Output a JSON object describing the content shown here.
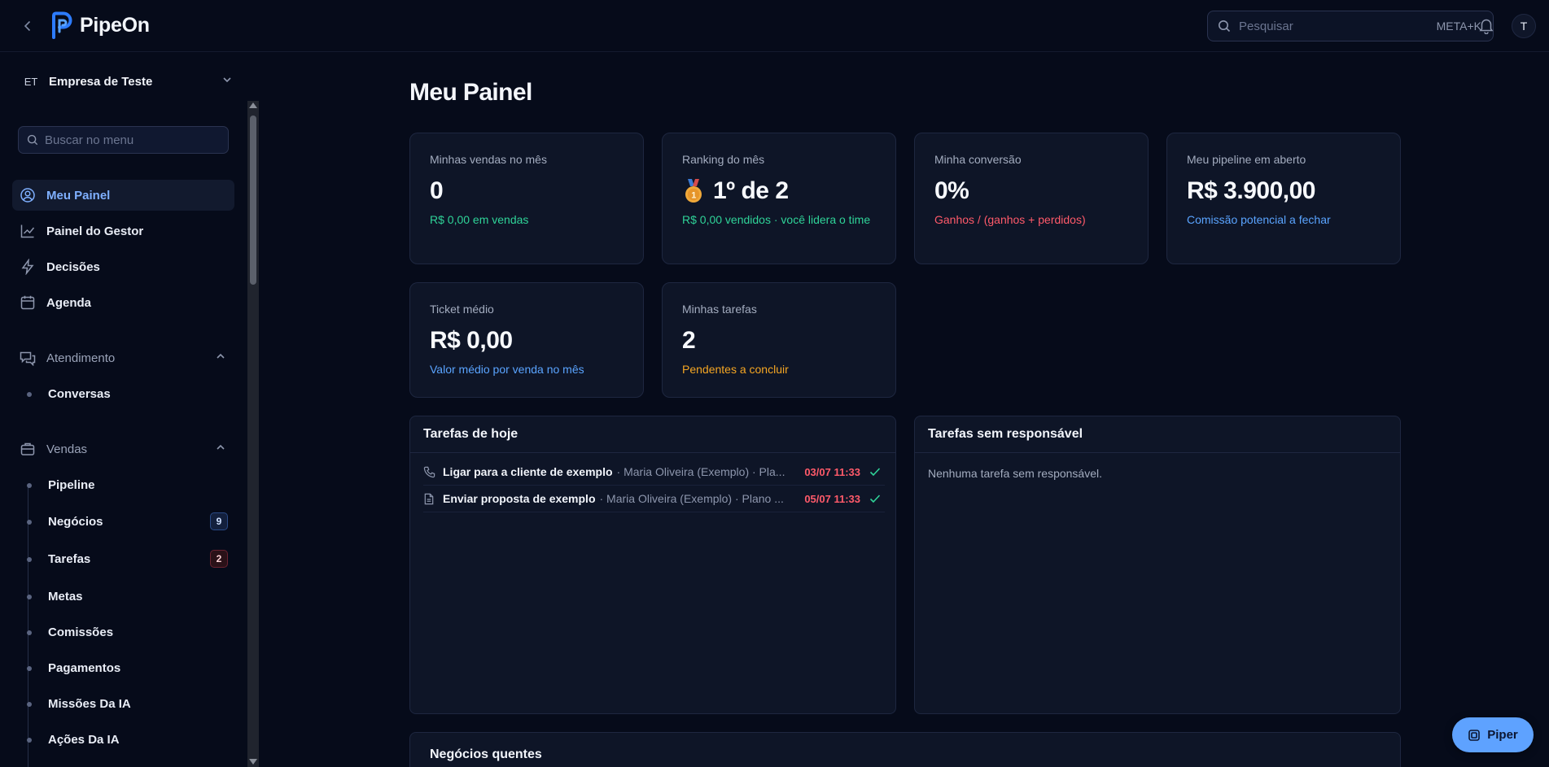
{
  "app": {
    "name": "PipeOn"
  },
  "header": {
    "search_placeholder": "Pesquisar",
    "shortcut": "META+K",
    "avatar_initial": "T"
  },
  "sidebar": {
    "company_initials": "ET",
    "company_name": "Empresa de Teste",
    "search_placeholder": "Buscar no menu",
    "items": [
      {
        "label": "Meu Painel",
        "icon": "user-circle-icon"
      },
      {
        "label": "Painel do Gestor",
        "icon": "chart-line-icon"
      },
      {
        "label": "Decisões",
        "icon": "lightning-icon"
      },
      {
        "label": "Agenda",
        "icon": "calendar-icon"
      }
    ],
    "sections": [
      {
        "label": "Atendimento",
        "icon": "chat-icon",
        "items": [
          {
            "label": "Conversas"
          }
        ]
      },
      {
        "label": "Vendas",
        "icon": "briefcase-icon",
        "items": [
          {
            "label": "Pipeline"
          },
          {
            "label": "Negócios",
            "badge": "9"
          },
          {
            "label": "Tarefas",
            "badge": "2"
          },
          {
            "label": "Metas"
          },
          {
            "label": "Comissões"
          },
          {
            "label": "Pagamentos"
          },
          {
            "label": "Missões Da IA"
          },
          {
            "label": "Ações Da IA"
          }
        ]
      }
    ]
  },
  "main": {
    "title": "Meu Painel",
    "kpis": [
      {
        "label": "Minhas vendas no mês",
        "value": "0",
        "sub": "R$ 0,00 em vendas"
      },
      {
        "label": "Ranking do mês",
        "value": "1º de 2",
        "sub": "R$ 0,00 vendidos · você lidera o time",
        "medal": "1"
      },
      {
        "label": "Minha conversão",
        "value": "0%",
        "sub": "Ganhos / (ganhos + perdidos)"
      },
      {
        "label": "Meu pipeline em aberto",
        "value": "R$ 3.900,00",
        "sub": "Comissão potencial a fechar"
      },
      {
        "label": "Ticket médio",
        "value": "R$ 0,00",
        "sub": "Valor médio por venda no mês"
      },
      {
        "label": "Minhas tarefas",
        "value": "2",
        "sub": "Pendentes a concluir"
      }
    ],
    "today_tasks": {
      "title": "Tarefas de hoje",
      "rows": [
        {
          "icon": "phone-icon",
          "title": "Ligar para a cliente de exemplo",
          "meta": "· Maria Oliveira (Exemplo) · Pla...",
          "date": "03/07 11:33"
        },
        {
          "icon": "document-icon",
          "title": "Enviar proposta de exemplo",
          "meta": "· Maria Oliveira (Exemplo) · Plano ...",
          "date": "05/07 11:33"
        }
      ]
    },
    "unassigned_tasks": {
      "title": "Tarefas sem responsável",
      "empty": "Nenhuma tarefa sem responsável."
    },
    "hot_deals": {
      "title": "Negócios quentes"
    }
  },
  "piper": {
    "label": "Piper"
  },
  "colors": {
    "background": "#060b1a",
    "accent": "#5ea2ff",
    "positive": "#2fd398",
    "negative": "#ff5a6a",
    "warning": "#f5a623"
  }
}
